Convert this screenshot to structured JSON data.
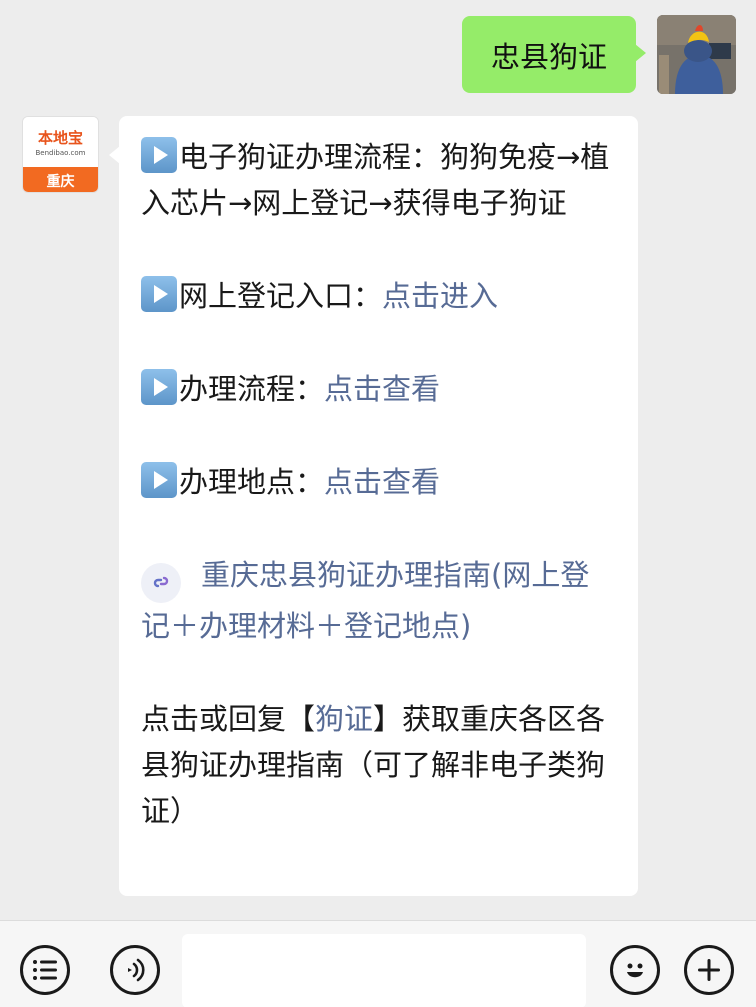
{
  "outgoing": {
    "text": "忠县狗证"
  },
  "bot": {
    "logo_text": "本地宝",
    "logo_sub": "Bendibao.com",
    "logo_city": "重庆"
  },
  "incoming": {
    "p1": "电子狗证办理流程：狗狗免疫→植入芯片→网上登记→获得电子狗证",
    "p2_label": "网上登记入口：",
    "p2_link": "点击进入",
    "p3_label": "办理流程：",
    "p3_link": "点击查看",
    "p4_label": "办理地点：",
    "p4_link": "点击查看",
    "miniprogram_link": "重庆忠县狗证办理指南(网上登记＋办理材料＋登记地点)",
    "p6_before": "点击或回复【",
    "p6_keyword": "狗证",
    "p6_after": "】获取重庆各区各县狗证办理指南（可了解非电子类狗证）"
  },
  "colors": {
    "outgoing_bubble": "#95ec69",
    "link": "#576b95",
    "background": "#ededed"
  },
  "icons": {
    "menu": "list-menu-icon",
    "voice": "voice-icon",
    "emoji": "emoji-icon",
    "plus": "plus-icon",
    "play": "play-icon",
    "miniprogram": "miniprogram-link-icon"
  }
}
